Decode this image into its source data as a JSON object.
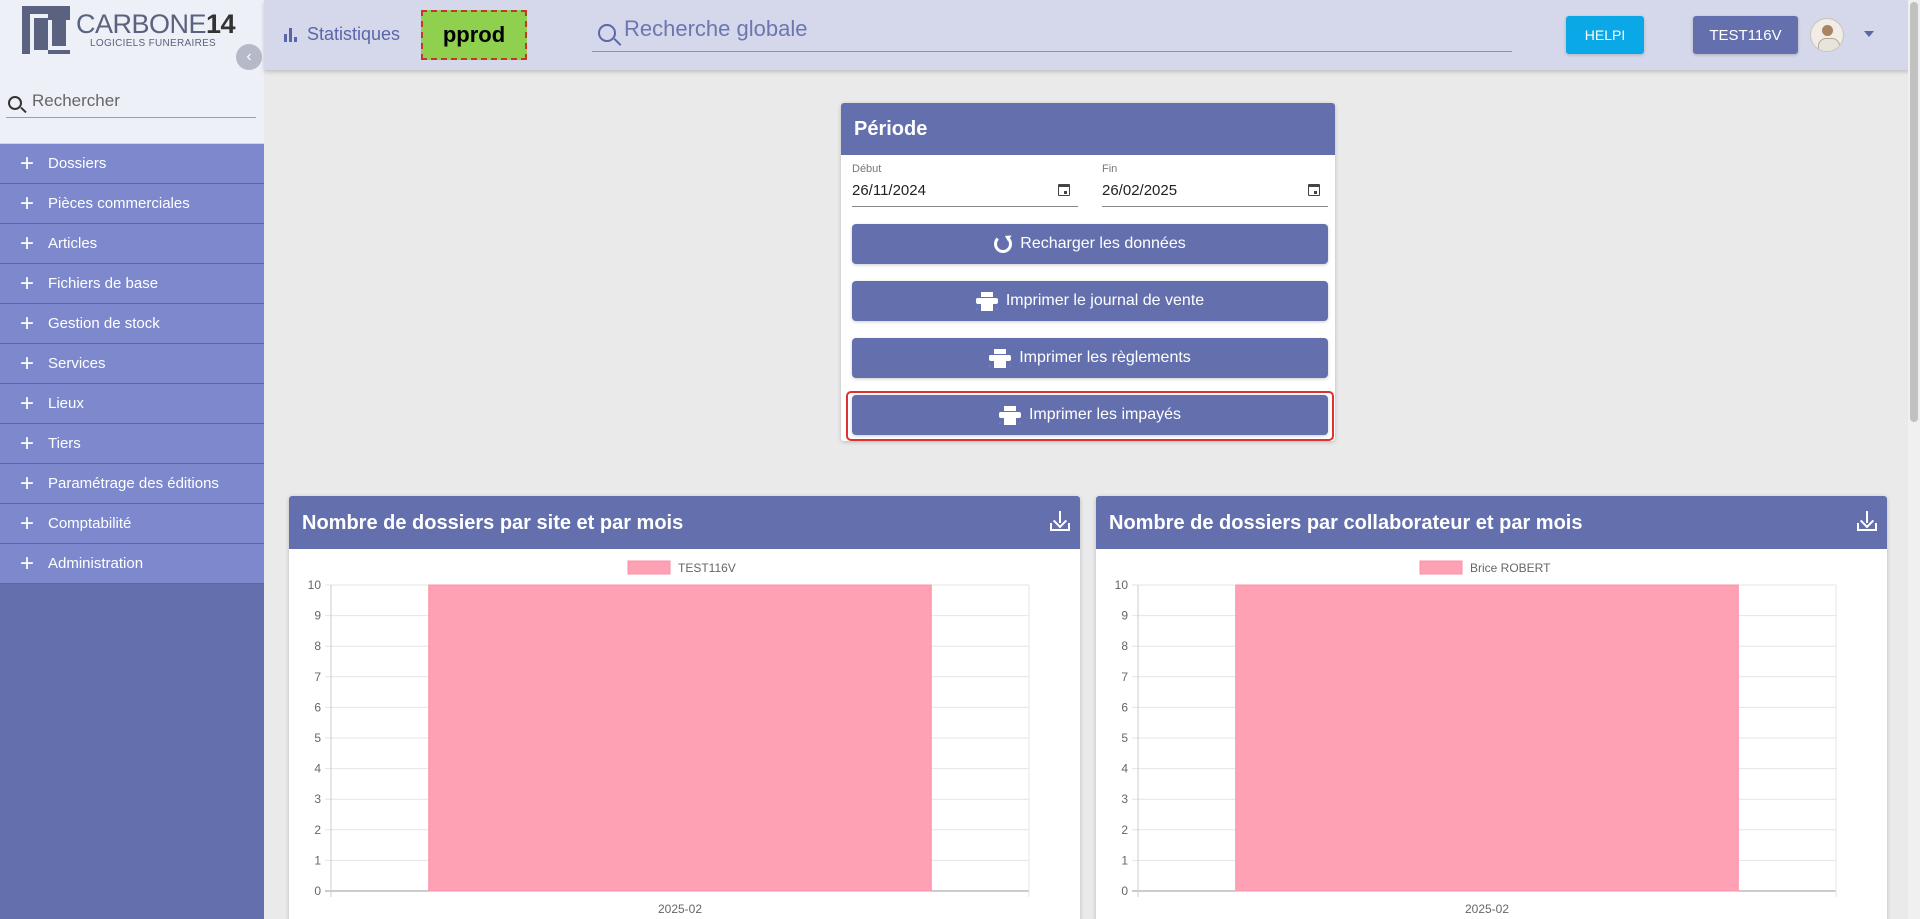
{
  "sidebar": {
    "logo_title": "CARBONE",
    "logo_title_num": "14",
    "logo_subtitle": "LOGICIELS FUNERAIRES",
    "search_placeholder": "Rechercher",
    "items": [
      {
        "label": "Dossiers"
      },
      {
        "label": "Pièces commerciales"
      },
      {
        "label": "Articles"
      },
      {
        "label": "Fichiers de base"
      },
      {
        "label": "Gestion de stock"
      },
      {
        "label": "Services"
      },
      {
        "label": "Lieux"
      },
      {
        "label": "Tiers"
      },
      {
        "label": "Paramétrage des éditions"
      },
      {
        "label": "Comptabilité"
      },
      {
        "label": "Administration"
      }
    ]
  },
  "header": {
    "stats_label": "Statistiques",
    "env_badge": "pprod",
    "search_placeholder": "Recherche globale",
    "helpi_label": "HELPI",
    "user_label": "TEST116V"
  },
  "periode": {
    "title": "Période",
    "start_label": "Début",
    "start_value": "26/11/2024",
    "end_label": "Fin",
    "end_value": "26/02/2025",
    "buttons": {
      "reload": "Recharger les données",
      "journal": "Imprimer le journal de vente",
      "reglements": "Imprimer les règlements",
      "impayes": "Imprimer les impayés"
    }
  },
  "colors": {
    "primary": "#6470ae",
    "bar_fill": "#ffa1b5",
    "bar_border": "#ff8fa8",
    "env_badge": "#8fd14f",
    "helpi": "#0aa8e6",
    "highlight_border": "#e03131"
  },
  "chart_data": [
    {
      "type": "bar",
      "title": "Nombre de dossiers par site et par mois",
      "categories": [
        "2025-02"
      ],
      "series": [
        {
          "name": "TEST116V",
          "values": [
            10
          ]
        }
      ],
      "ylim": [
        0,
        10
      ],
      "yticks": [
        0,
        1,
        2,
        3,
        4,
        5,
        6,
        7,
        8,
        9,
        10
      ],
      "legend": "top",
      "grid": true
    },
    {
      "type": "bar",
      "title": "Nombre de dossiers par collaborateur et par mois",
      "categories": [
        "2025-02"
      ],
      "series": [
        {
          "name": "Brice ROBERT",
          "values": [
            10
          ]
        }
      ],
      "ylim": [
        0,
        10
      ],
      "yticks": [
        0,
        1,
        2,
        3,
        4,
        5,
        6,
        7,
        8,
        9,
        10
      ],
      "legend": "top",
      "grid": true
    }
  ]
}
